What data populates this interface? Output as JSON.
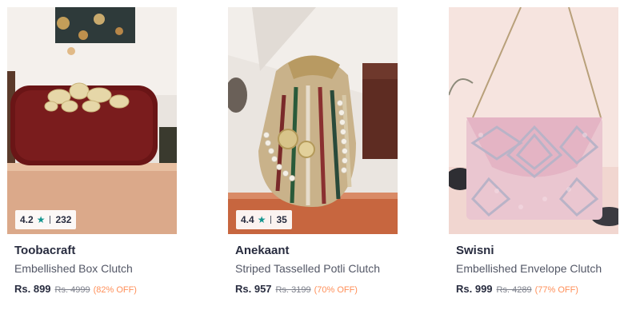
{
  "products": [
    {
      "brand": "Toobacraft",
      "name": "Embellished Box Clutch",
      "price": "Rs. 899",
      "mrp": "Rs. 4999",
      "discount": "(82% OFF)",
      "rating": "4.2",
      "rating_count": "232",
      "image_alt": "maroon embellished box clutch"
    },
    {
      "brand": "Anekaant",
      "name": "Striped Tasselled Potli Clutch",
      "price": "Rs. 957",
      "mrp": "Rs. 3199",
      "discount": "(70% OFF)",
      "rating": "4.4",
      "rating_count": "35",
      "image_alt": "striped potli clutch with pearls"
    },
    {
      "brand": "Swisni",
      "name": "Embellished Envelope Clutch",
      "price": "Rs. 999",
      "mrp": "Rs. 4289",
      "discount": "(77% OFF)",
      "image_alt": "pink embellished envelope clutch"
    }
  ],
  "icons": {
    "rating_star": "star-icon"
  },
  "colors": {
    "rating_star": "#14958f",
    "discount": "#ff905a",
    "brand_text": "#282c3f",
    "name_text": "#535766",
    "mrp_text": "#7e818c"
  }
}
